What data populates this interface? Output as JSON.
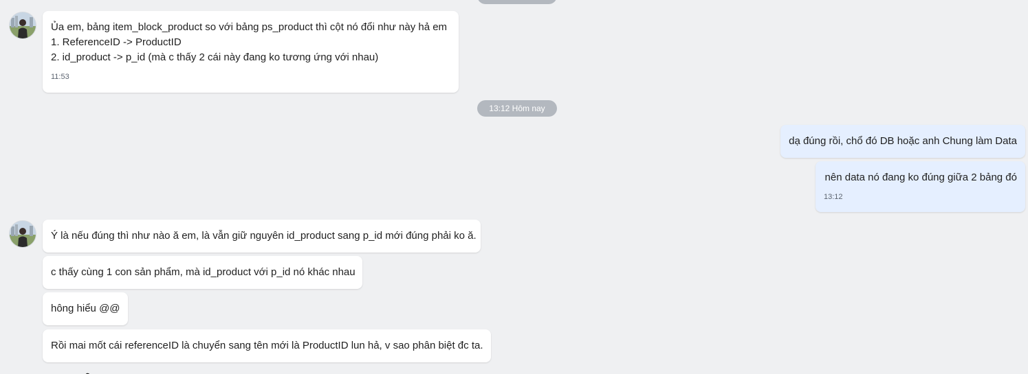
{
  "conversation": {
    "date_divider": "13:12 Hôm nay",
    "messages": [
      {
        "sender": "other",
        "lines": [
          "Ủa em, bảng item_block_product so với bảng ps_product thì cột nó đổi như này hả em",
          "1. ReferenceID -> ProductID",
          "2. id_product -> p_id (mà c thấy 2 cái này đang ko tương ứng với nhau)"
        ],
        "time": "11:53"
      },
      {
        "sender": "me",
        "text": "dạ đúng rồi, chổ đó DB hoặc anh Chung làm Data"
      },
      {
        "sender": "me",
        "text": "nên data nó đang ko đúng giữa 2 bảng đó",
        "time": "13:12"
      },
      {
        "sender": "other",
        "text": "Ý là nếu đúng thì như nào ă em, là vẫn giữ nguyên id_product sang p_id mới đúng phải ko ă."
      },
      {
        "sender": "other",
        "text": "c thấy cùng 1 con sản phẩm, mà id_product với p_id nó khác nhau"
      },
      {
        "sender": "other",
        "text": "hông hiểu @@"
      },
      {
        "sender": "other",
        "text": "Rồi mai mốt cái referenceID là chuyển sang tên mới là ProductID lun hả, v sao phân biệt đc ta."
      }
    ]
  }
}
